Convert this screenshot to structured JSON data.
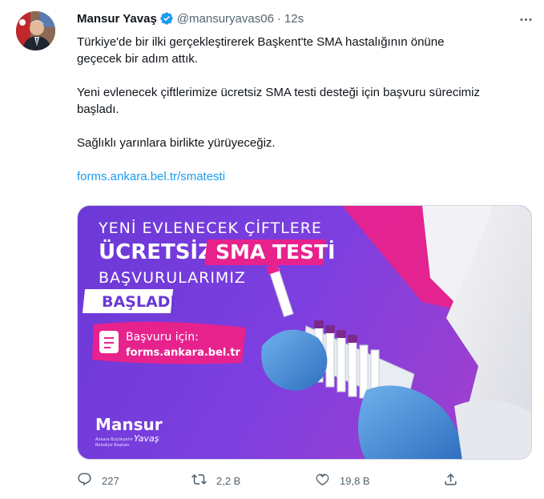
{
  "tweet": {
    "author_name": "Mansur Yavaş",
    "handle": "@mansuryavas06",
    "separator": "·",
    "time": "12s",
    "text_p1": "Türkiye'de bir ilki gerçekleştirerek Başkent'te SMA hastalığının önüne\ngeçecek bir adım attık.",
    "text_p2": "Yeni evlenecek çiftlerimize ücretsiz SMA testi desteği için başvuru sürecimiz\nbaşladı.",
    "text_p3": "Sağlıklı yarınlara birlikte yürüyeceğiz.",
    "link": "forms.ankara.bel.tr/smatesti"
  },
  "media": {
    "line1": "YENİ EVLENECEK ÇİFTLERE",
    "line2a": "ÜCRETSİZ",
    "line2b": "SMA TESTİ",
    "line3": "BAŞVURULARIMIZ",
    "line4": "BAŞLADI",
    "apply_label": "Başvuru için:",
    "apply_url": "forms.ankara.bel.tr",
    "logo_name": "Mansur",
    "logo_script": "Yavaş",
    "logo_sub1": "Ankara Büyükşehir",
    "logo_sub2": "Belediye Başkanı",
    "colors": {
      "purple": "#7a3fe0",
      "pink": "#e8228c",
      "glove": "#4a90d9"
    }
  },
  "actions": {
    "reply_count": "227",
    "retweet_count": "2,2 B",
    "like_count": "19,8 B"
  },
  "icons": [
    "verified-icon",
    "more-icon",
    "reply-icon",
    "retweet-icon",
    "like-icon",
    "share-icon"
  ]
}
